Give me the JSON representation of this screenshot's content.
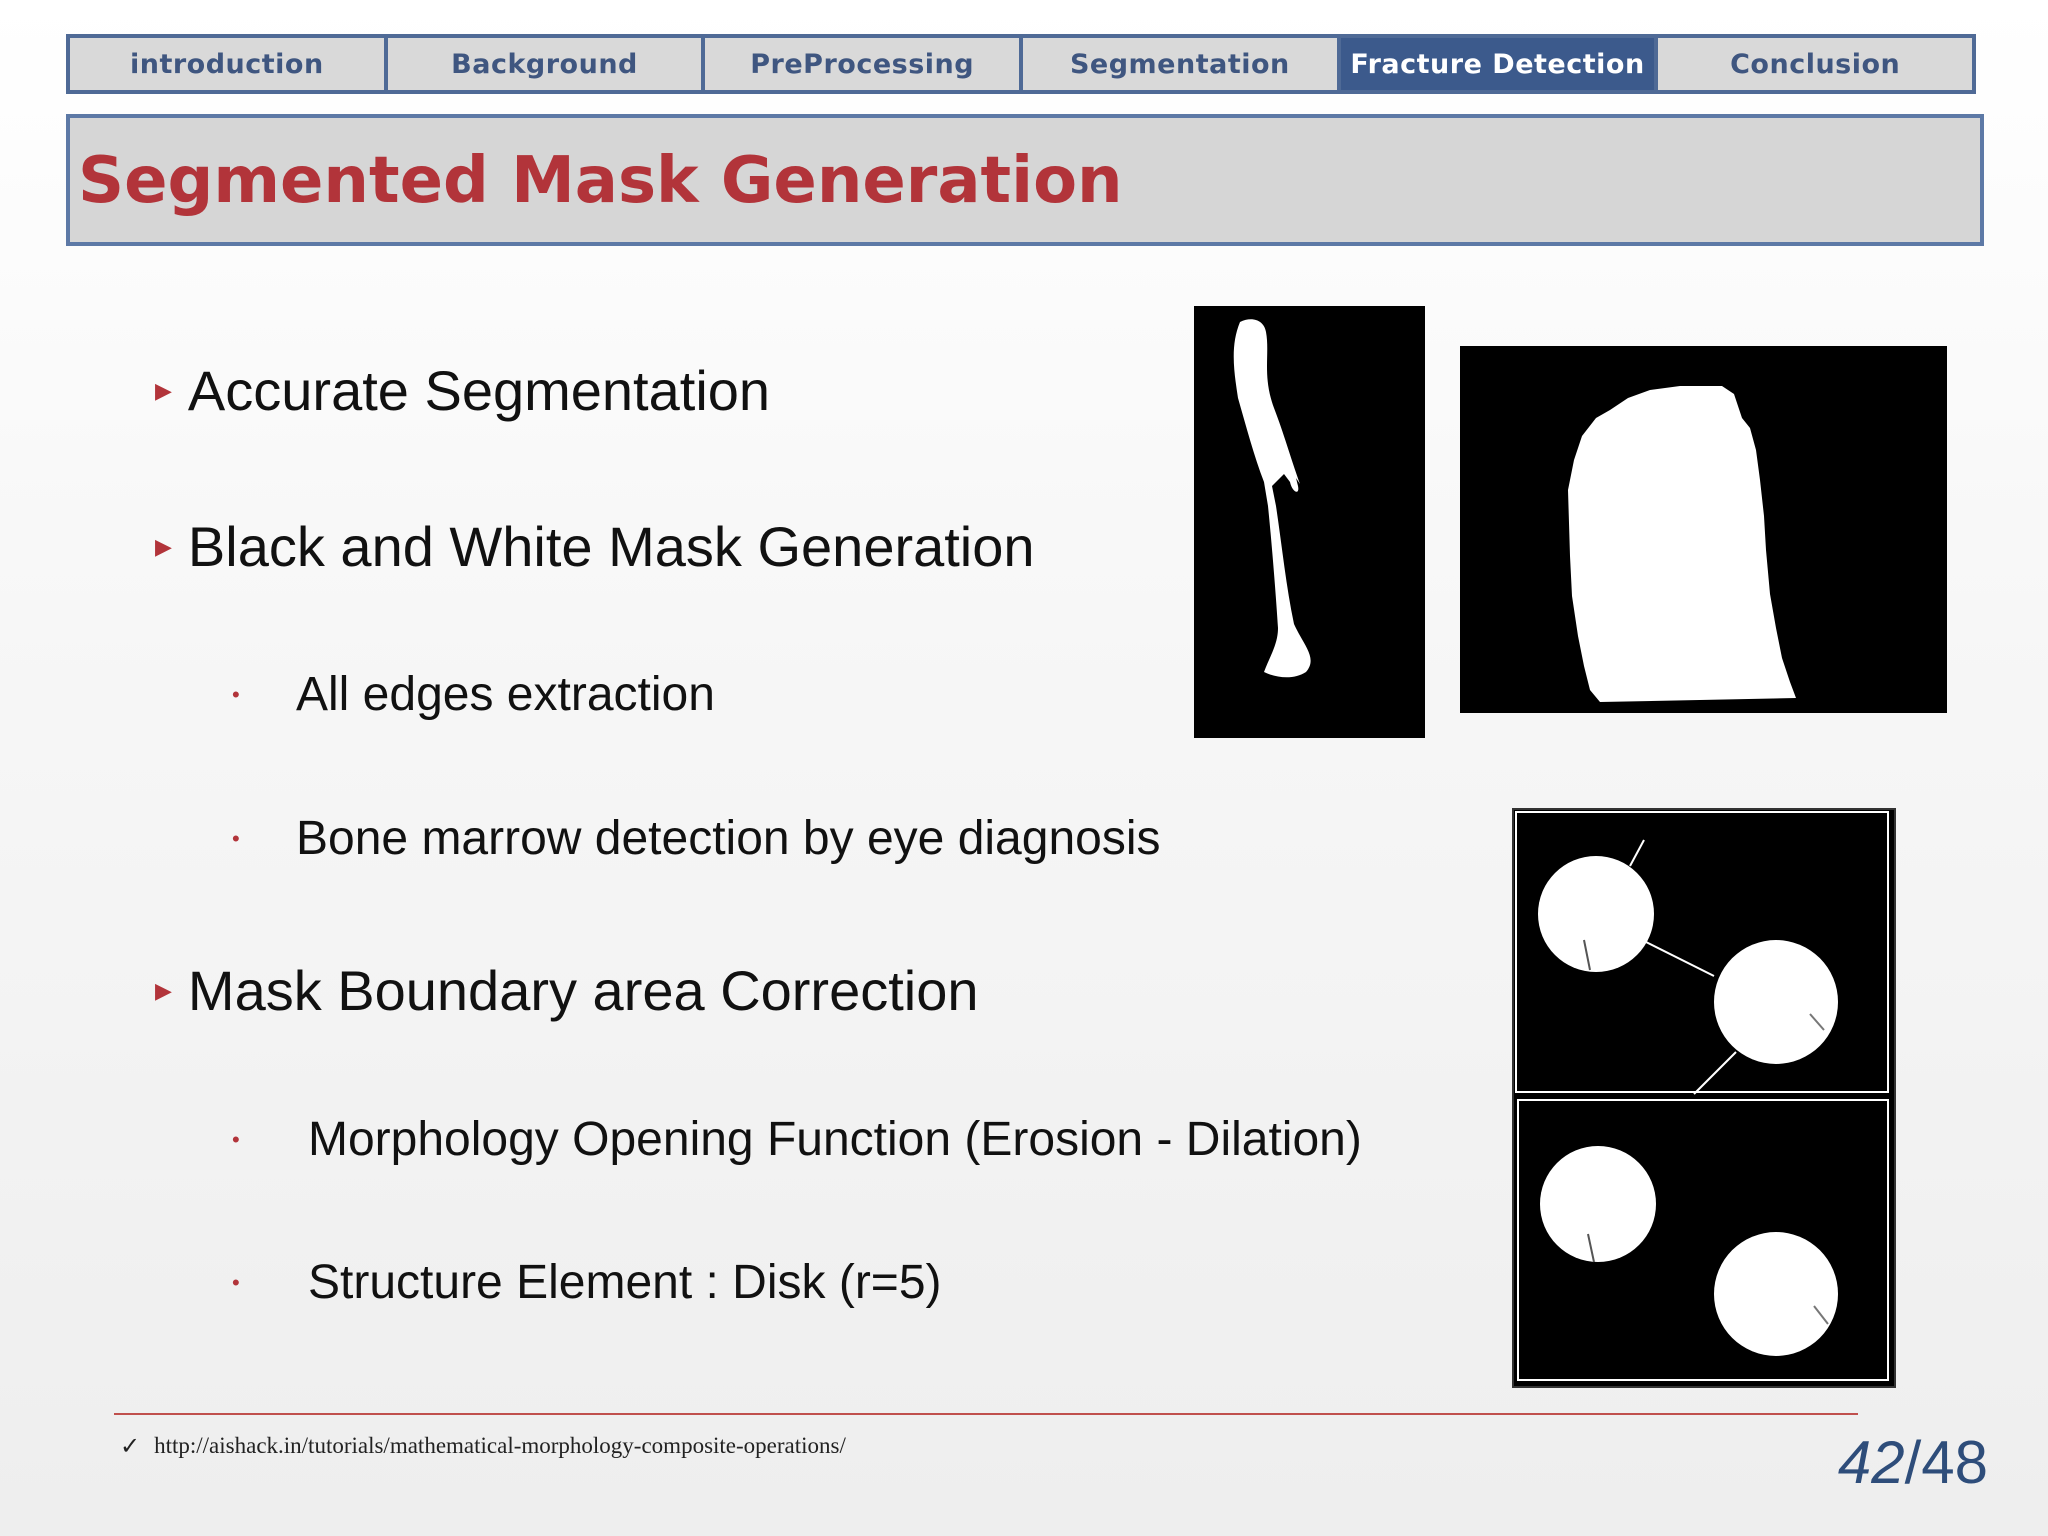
{
  "nav": {
    "tabs": [
      {
        "label": "introduction"
      },
      {
        "label": "Background"
      },
      {
        "label": "PreProcessing"
      },
      {
        "label": "Segmentation"
      },
      {
        "label": "Fracture Detection"
      },
      {
        "label": "Conclusion"
      }
    ],
    "active_index": 4
  },
  "slide": {
    "title": "Segmented Mask Generation",
    "bullets": [
      {
        "text": "Accurate Segmentation"
      },
      {
        "text": "Black and White Mask Generation"
      },
      {
        "text": "All edges extraction"
      },
      {
        "text": "Bone marrow detection by eye diagnosis"
      },
      {
        "text": "Mask Boundary area Correction"
      },
      {
        "text": "Morphology Opening Function (Erosion - Dilation)"
      },
      {
        "text": "Structure Element : Disk (r=5)"
      }
    ]
  },
  "footer": {
    "check": "✓",
    "reference": "http://aishack.in/tutorials/mathematical-morphology-composite-operations/",
    "page_current": "42",
    "page_total": "/48"
  },
  "colors": {
    "accent_red": "#b2343a",
    "nav_blue": "#3c5a8c",
    "title_bg": "#d6d6d6"
  }
}
